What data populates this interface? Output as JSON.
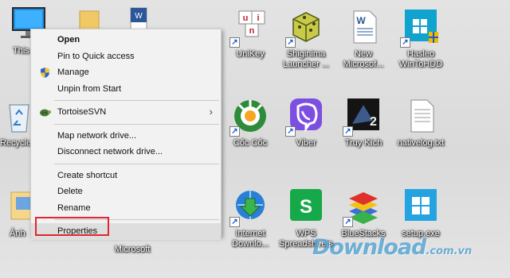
{
  "desktop_icons": {
    "this_pc": "This",
    "recycle_bin": "Recycle",
    "anh": "Ảnh",
    "word_doc_partial": "",
    "hidden_microsoft": "Microsoft",
    "unikey": "UniKey",
    "shiginima": "Shiginima\nLauncher ...",
    "new_microsoft": "New\nMicrosof...",
    "hasleo": "Hasleo\nWinToHDD",
    "coc_coc": "Cốc Cốc",
    "viber": "Viber",
    "truy_kich": "Truy Kích",
    "nativelog": "nativelog.txt",
    "idm": "Internet\nDownlo...",
    "wps": "WPS\nSpreadsheets",
    "bluestacks": "BlueStacks",
    "setup": "setup.exe"
  },
  "context_menu": {
    "items": [
      "Open",
      "Pin to Quick access",
      "Manage",
      "Unpin from Start",
      "TortoiseSVN",
      "Map network drive...",
      "Disconnect network drive...",
      "Create shortcut",
      "Delete",
      "Rename",
      "Properties"
    ],
    "submenu_indicator": "›"
  },
  "watermark": {
    "text": "Download",
    "domain": ".com.vn"
  },
  "colors": {
    "highlight_border": "#e0252e",
    "menu_bg": "#f2f2f2",
    "watermark": "#0078be"
  }
}
